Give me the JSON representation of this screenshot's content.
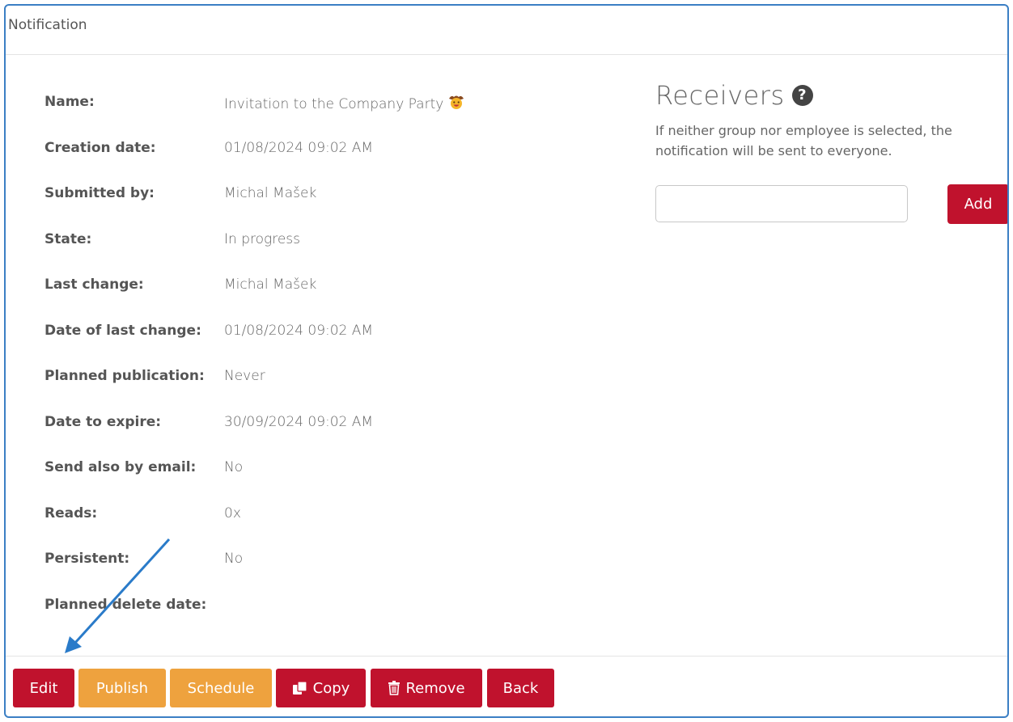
{
  "header": {
    "title": "Notification"
  },
  "details": [
    {
      "label": "Name:",
      "value": "Invitation to the Company Party",
      "emoji": "cowboy-face-icon"
    },
    {
      "label": "Creation date:",
      "value": "01/08/2024 09:02 AM"
    },
    {
      "label": "Submitted by:",
      "value": "Michal Mašek"
    },
    {
      "label": "State:",
      "value": "In progress"
    },
    {
      "label": "Last change:",
      "value": "Michal Mašek"
    },
    {
      "label": "Date of last change:",
      "value": "01/08/2024 09:02 AM"
    },
    {
      "label": "Planned publication:",
      "value": "Never"
    },
    {
      "label": "Date to expire:",
      "value": "30/09/2024 09:02 AM"
    },
    {
      "label": "Send also by email:",
      "value": "No"
    },
    {
      "label": "Reads:",
      "value": "0x"
    },
    {
      "label": "Persistent:",
      "value": "No"
    },
    {
      "label": "Planned delete date:",
      "value": ""
    }
  ],
  "receivers": {
    "title": "Receivers",
    "help_icon": "question-circle-icon",
    "hint": "If neither group nor employee is selected, the notification will be sent to everyone.",
    "input_value": "",
    "add_label": "Add"
  },
  "footer": {
    "edit_label": "Edit",
    "publish_label": "Publish",
    "schedule_label": "Schedule",
    "copy_label": "Copy",
    "copy_icon": "copy-icon",
    "remove_label": "Remove",
    "remove_icon": "trash-icon",
    "back_label": "Back"
  },
  "colors": {
    "primary_red": "#c0122d",
    "orange": "#eea23e",
    "frame_blue": "#3b7fc4",
    "annotation_arrow": "#2a7bc9"
  }
}
